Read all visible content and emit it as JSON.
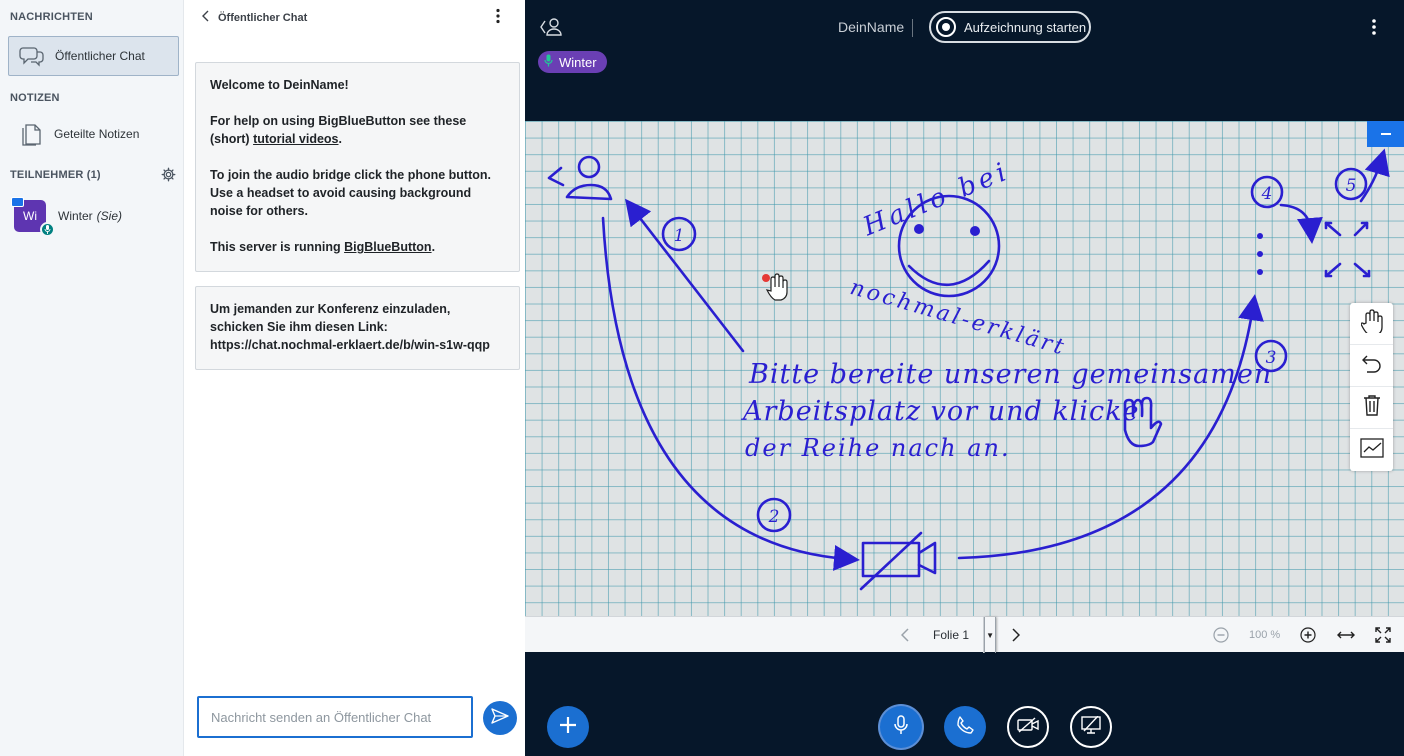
{
  "sidebar": {
    "messages_title": "NACHRICHTEN",
    "public_chat_label": "Öffentlicher Chat",
    "notes_title": "NOTIZEN",
    "shared_notes_label": "Geteilte Notizen",
    "participants_title": "TEILNEHMER (1)",
    "user": {
      "initials": "Wi",
      "name": "Winter",
      "you_label": "(Sie)"
    }
  },
  "chat": {
    "header_title": "Öffentlicher Chat",
    "welcome": {
      "line1_prefix": "Welcome to ",
      "line1_name": "DeinName",
      "line1_suffix": "!",
      "help_text": "For help on using BigBlueButton see these (short) ",
      "help_link": "tutorial videos",
      "help_end": ".",
      "audio_text": "To join the audio bridge click the phone button. Use a headset to avoid causing background noise for others.",
      "server_prefix": "This server is running ",
      "server_link": "BigBlueButton",
      "server_end": "."
    },
    "invite": {
      "text": "Um jemanden zur Konferenz einzuladen, schicken Sie ihm diesen Link:",
      "link": "https://chat.nochmal-erklaert.de/b/win-s1w-qqp"
    },
    "input_placeholder": "Nachricht senden an Öffentlicher Chat"
  },
  "topbar": {
    "meeting_name": "DeinName",
    "separator": "|",
    "record_label": "Aufzeichnung starten",
    "talking_indicator": "Winter"
  },
  "whiteboard": {
    "greeting_line1": "Hallo bei",
    "greeting_line2": "nochmal-erklärt",
    "instructions": [
      "Bitte bereite unseren gemeinsamen",
      "Arbeitsplatz vor und klicke",
      "der Reihe nach an."
    ],
    "steps": [
      "1",
      "2",
      "3",
      "4",
      "5"
    ]
  },
  "presentation_controls": {
    "slide_label": "Folie 1",
    "zoom_label": "100 %"
  },
  "colors": {
    "primary": "#1b6fd1",
    "dark_bg": "#06172a",
    "talker": "#6a3fb4",
    "ink": "#2a1fd0"
  }
}
